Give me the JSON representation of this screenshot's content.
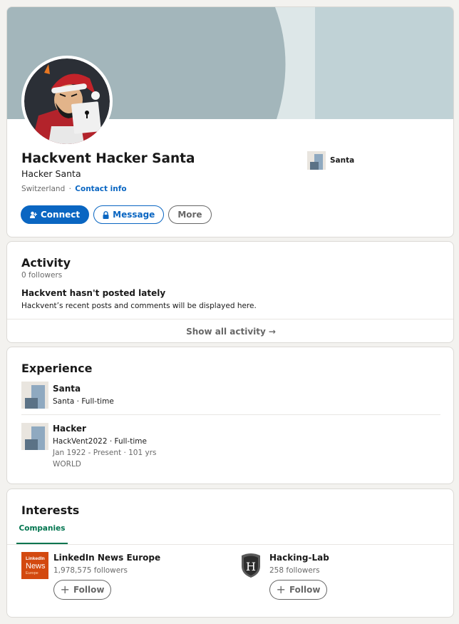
{
  "profile": {
    "name": "Hackvent Hacker Santa",
    "headline": "Hacker Santa",
    "location": "Switzerland",
    "separator": "·",
    "contact_info": "Contact info",
    "buttons": {
      "connect": "Connect",
      "message": "Message",
      "more": "More"
    },
    "current_company": "Santa"
  },
  "activity": {
    "title": "Activity",
    "followers": "0 followers",
    "empty_title": "Hackvent hasn't posted lately",
    "empty_desc": "Hackvent’s recent posts and comments will be displayed here.",
    "show_all": "Show all activity",
    "arrow": "→"
  },
  "experience": {
    "title": "Experience",
    "items": [
      {
        "title": "Santa",
        "company_line": "Santa · Full-time"
      },
      {
        "title": "Hacker",
        "company_line": "HackVent2022 · Full-time",
        "dates": "Jan 1922 - Present · 101 yrs",
        "location": "WORLD"
      }
    ]
  },
  "interests": {
    "title": "Interests",
    "tab": "Companies",
    "items": [
      {
        "name": "LinkedIn News Europe",
        "followers": "1,978,575 followers",
        "follow": "Follow",
        "logo_text": [
          "LinkedIn",
          "News",
          "Europe"
        ]
      },
      {
        "name": "Hacking-Lab",
        "followers": "258 followers",
        "follow": "Follow",
        "logo_text": "H"
      }
    ]
  },
  "colors": {
    "primary": "#0a66c2",
    "green_tab": "#01754f",
    "banner": "#c0d2d6",
    "banner_dark": "#a3b6bb",
    "placeholder_logo": "#8fa9c0"
  }
}
